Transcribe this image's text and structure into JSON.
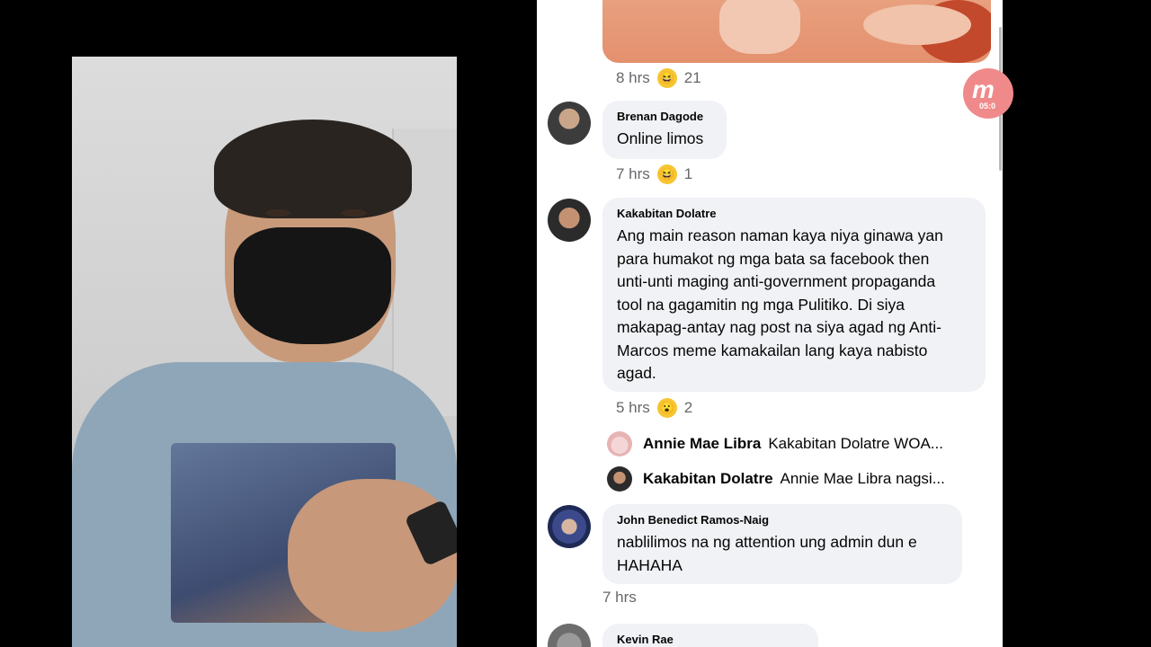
{
  "recording_badge": {
    "letter": "m",
    "time": "05:0"
  },
  "post_meta": {
    "time": "8 hrs",
    "reaction_icon": "laugh-emoji",
    "reaction_count": "21"
  },
  "comments": [
    {
      "name": "Brenan Dagode",
      "text": "Online limos",
      "time": "7 hrs",
      "reaction_icon": "laugh-emoji",
      "reaction_count": "1"
    },
    {
      "name": "Kakabitan Dolatre",
      "text": "Ang main reason naman kaya niya ginawa yan para humakot ng mga bata sa facebook then unti-unti maging anti-government propaganda tool na gagamitin ng mga Pulitiko. Di siya makapag-antay nag post na siya agad ng Anti-Marcos meme kamakailan lang kaya nabisto agad.",
      "lines": [
        "Ang main reason naman kaya niya ginawa yan",
        "para humakot ng mga bata sa facebook then",
        "unti-unti maging anti-government propaganda",
        "tool na gagamitin ng mga Pulitiko. Di siya",
        "makapag-antay nag post na siya agad ng Anti-",
        "Marcos meme kamakailan lang kaya nabisto",
        "agad."
      ],
      "time": "5 hrs",
      "reaction_icon": "wow-emoji",
      "reaction_count": "2",
      "replies": [
        {
          "name": "Annie Mae Libra",
          "text": "Kakabitan Dolatre WOA..."
        },
        {
          "name": "Kakabitan Dolatre",
          "text": "Annie Mae Libra nagsi..."
        }
      ]
    },
    {
      "name": "John Benedict Ramos-Naig",
      "lines": [
        "nablilimos na ng attention ung admin dun e",
        "HAHAHA"
      ],
      "time": "7 hrs"
    },
    {
      "name": "Kevin Rae"
    }
  ]
}
